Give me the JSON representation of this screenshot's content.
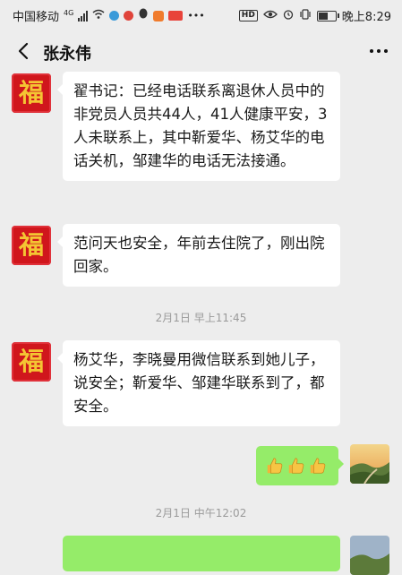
{
  "status_bar": {
    "carrier": "中国移动",
    "network": "4G",
    "time": "晚上8:29",
    "hd_badge": "HD",
    "battery_level": 0.55
  },
  "header": {
    "title": "张永伟"
  },
  "avatar_glyph": "福",
  "messages": [
    {
      "side": "left",
      "text": "翟书记：已经电话联系离退休人员中的非党员人员共44人，41人健康平安，3人未联系上，其中靳爱华、杨艾华的电话关机，邹建华的电话无法接通。"
    },
    {
      "side": "left",
      "text": "范问天也安全，年前去住院了，刚出院回家。"
    },
    {
      "side": "left",
      "text": "杨艾华，李晓曼用微信联系到她儿子，说安全；靳爱华、邹建华联系到了，都安全。"
    }
  ],
  "timestamps": [
    "2月1日 早上11:45",
    "2月1日 中午12:02"
  ],
  "reply": {
    "side": "right",
    "content": "thumbs-up-emoji x3"
  }
}
